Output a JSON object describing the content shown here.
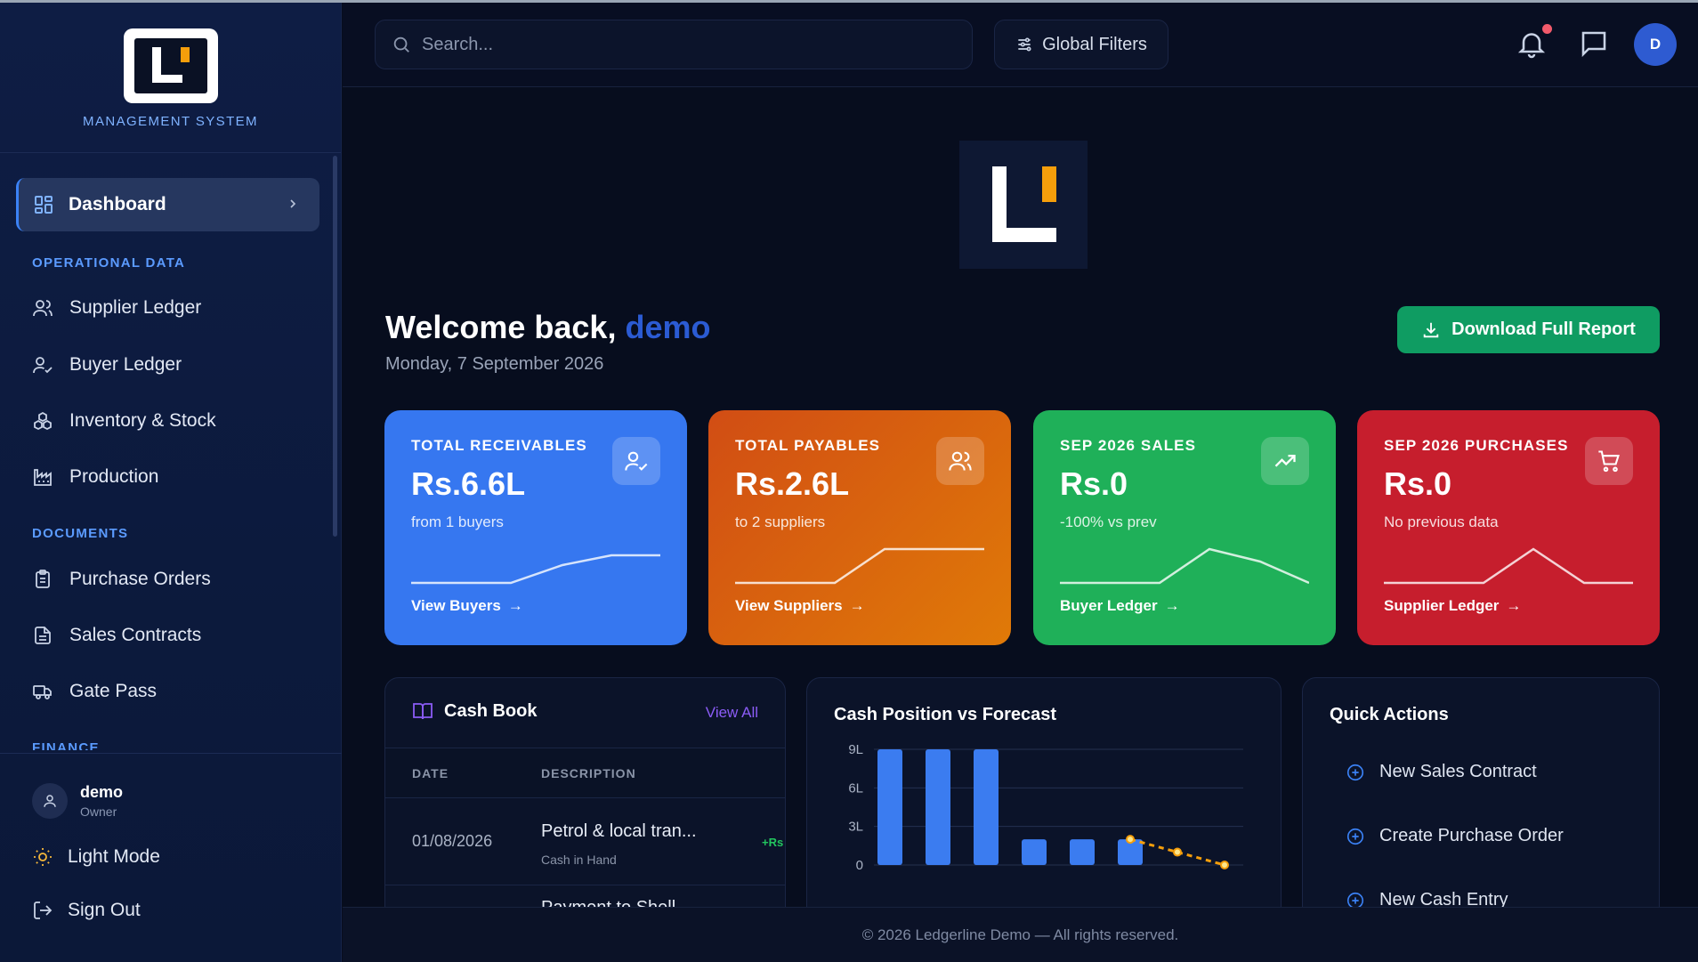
{
  "brand": {
    "subtitle": "MANAGEMENT SYSTEM"
  },
  "nav": {
    "active": {
      "label": "Dashboard"
    },
    "sections": {
      "operational": "OPERATIONAL DATA",
      "documents": "DOCUMENTS",
      "finance": "FINANCE"
    },
    "items": [
      {
        "label": "Supplier Ledger"
      },
      {
        "label": "Buyer Ledger"
      },
      {
        "label": "Inventory & Stock"
      },
      {
        "label": "Production"
      },
      {
        "label": "Purchase Orders"
      },
      {
        "label": "Sales Contracts"
      },
      {
        "label": "Gate Pass"
      }
    ]
  },
  "user": {
    "name": "demo",
    "role": "Owner",
    "initial": "D"
  },
  "footer_nav": {
    "theme_label": "Light Mode",
    "signout_label": "Sign Out"
  },
  "topbar": {
    "search_placeholder": "Search...",
    "filters_label": "Global Filters"
  },
  "welcome": {
    "prefix": "Welcome back,",
    "username": "demo",
    "date": "Monday, 7 September 2026"
  },
  "download_label": "Download Full Report",
  "kpis": [
    {
      "title": "TOTAL RECEIVABLES",
      "value": "Rs.6.6L",
      "sub": "from 1 buyers",
      "link": "View Buyers",
      "icon": "user-check-icon",
      "color": "#3b7cf0"
    },
    {
      "title": "TOTAL PAYABLES",
      "value": "Rs.2.6L",
      "sub": "to 2 suppliers",
      "link": "View Suppliers",
      "icon": "users-icon",
      "color": "#e06614"
    },
    {
      "title": "SEP 2026 SALES",
      "value": "Rs.0",
      "sub": "-100% vs prev",
      "link": "Buyer Ledger",
      "icon": "trending-up-icon",
      "color": "#1fae55"
    },
    {
      "title": "SEP 2026 PURCHASES",
      "value": "Rs.0",
      "sub": "No previous data",
      "link": "Supplier Ledger",
      "icon": "cart-icon",
      "color": "#c81e2e"
    }
  ],
  "cashbook": {
    "title": "Cash Book",
    "view_all": "View All",
    "columns": [
      "DATE",
      "DESCRIPTION"
    ],
    "rows": [
      {
        "date": "01/08/2026",
        "description": "Petrol & local tran...",
        "account": "Cash in Hand",
        "amount": "+Rs"
      },
      {
        "date": "",
        "description": "Payment to Shell...",
        "account": "",
        "amount": ""
      }
    ]
  },
  "chart_data": {
    "type": "bar",
    "title": "Cash Position vs Forecast",
    "y_ticks": [
      "9L",
      "6L",
      "3L",
      "0"
    ],
    "ylim": [
      0,
      9
    ],
    "bars": [
      9,
      9,
      9,
      2,
      2,
      2
    ],
    "forecast": [
      2,
      1,
      0
    ]
  },
  "quick_actions": {
    "title": "Quick Actions",
    "items": [
      {
        "label": "New Sales Contract"
      },
      {
        "label": "Create Purchase Order"
      },
      {
        "label": "New Cash Entry"
      }
    ]
  },
  "footer": {
    "copyright": "© 2026 Ledgerline Demo — All rights reserved."
  }
}
